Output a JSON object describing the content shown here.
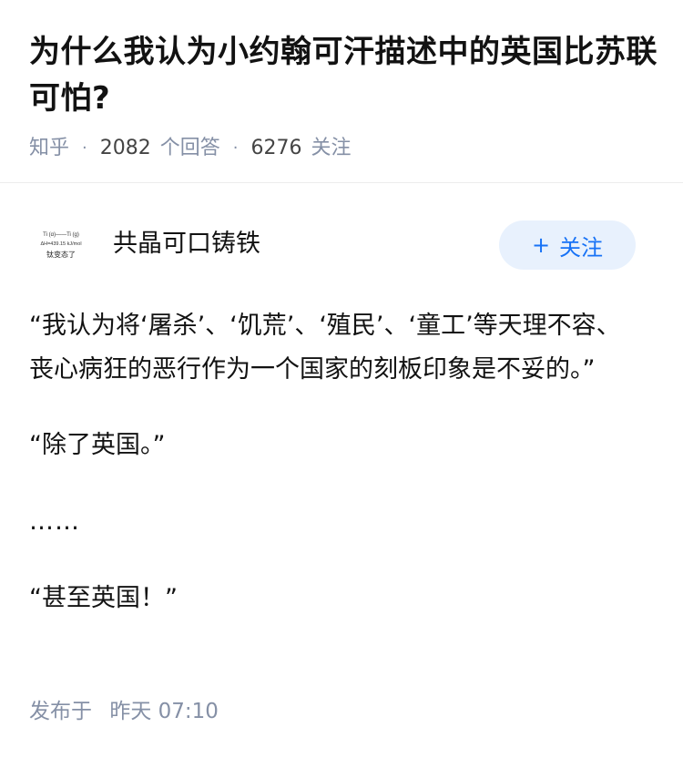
{
  "question": {
    "title": "为什么我认为小约翰可汗描述中的英国比苏联可怕?",
    "source": "知乎",
    "answer_count": "2082",
    "answer_label": "个回答",
    "follow_count": "6276",
    "follow_label": "关注",
    "separator": "·"
  },
  "author": {
    "name": "共晶可口铸铁",
    "avatar_text": {
      "line1": "Ti (α)——Ti (g)",
      "line2": "ΔH=439.15 kJ/mol",
      "line3": "钛变态了"
    },
    "follow_button_icon": "plus-icon",
    "follow_button_label": "关注"
  },
  "answer": {
    "paragraphs": [
      "“我认为将‘屠杀’、‘饥荒’、‘殖民’、‘童工’等天理不容、丧心病狂的恶行作为一个国家的刻板印象是不妥的。”",
      "“除了英国。”",
      "……",
      "“甚至英国！”"
    ]
  },
  "footer": {
    "publish_label": "发布于",
    "publish_time": "昨天 07:10"
  },
  "colors": {
    "accent": "#1772f6",
    "follow_bg": "#e8f1fd",
    "meta_gray": "#8590a6",
    "text": "#121212"
  }
}
